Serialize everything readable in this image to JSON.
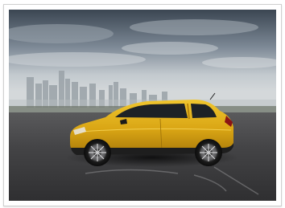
{
  "image": {
    "subject": "yellow-hatchback-car",
    "setting": "city-skyline-parking-lot",
    "colors": {
      "car_body": "#d9a514",
      "sky_top": "#3f4a56",
      "sky_horizon": "#c9cfd3",
      "asphalt": "#3d3d3f",
      "frame_border": "#cfcfcf"
    }
  }
}
